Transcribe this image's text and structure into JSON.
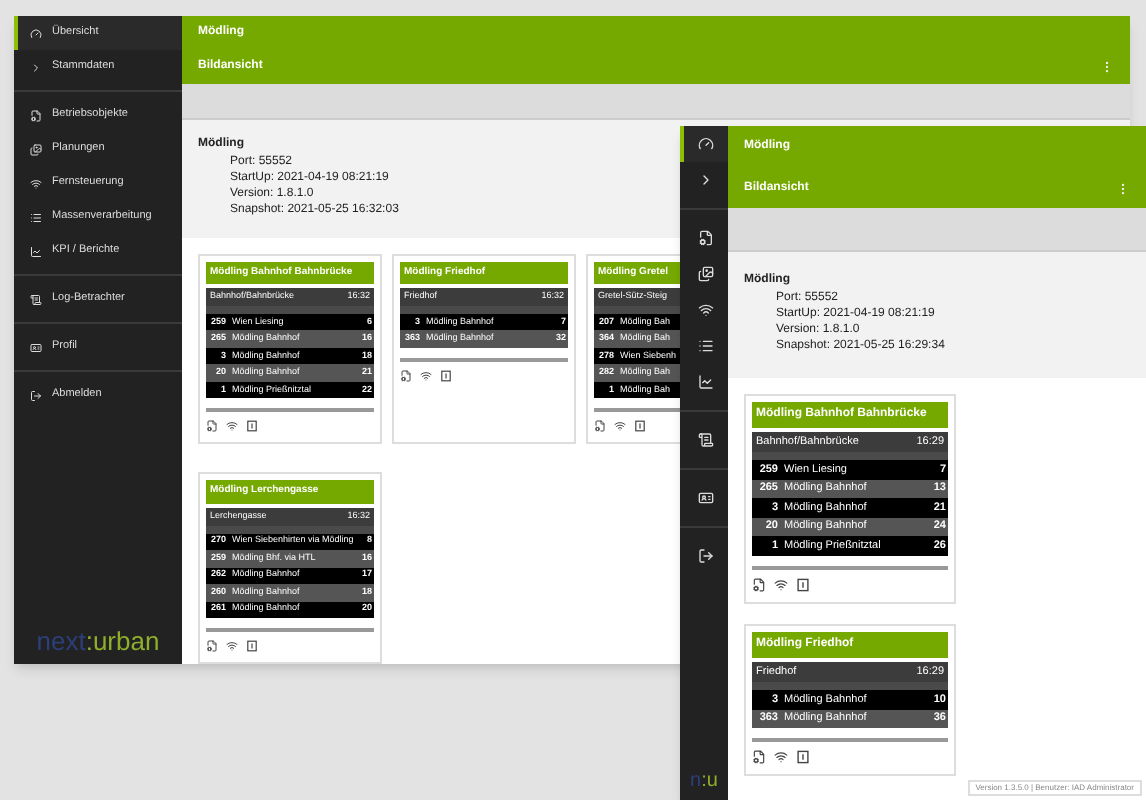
{
  "windows": [
    {
      "sidebar": {
        "collapsed": false,
        "items": [
          {
            "label": "Übersicht",
            "selected": true
          },
          {
            "label": "Stammdaten",
            "selected": false
          },
          {
            "label": "Betriebsobjekte",
            "selected": false
          },
          {
            "label": "Planungen",
            "selected": false
          },
          {
            "label": "Fernsteuerung",
            "selected": false
          },
          {
            "label": "Massenverarbeitung",
            "selected": false
          },
          {
            "label": "KPI / Berichte",
            "selected": false
          },
          {
            "label": "Log-Betrachter",
            "selected": false
          },
          {
            "label": "Profil",
            "selected": false
          },
          {
            "label": "Abmelden",
            "selected": false
          }
        ],
        "logo": [
          "next",
          ":urban"
        ]
      },
      "header": {
        "title": "Mödling",
        "subtitle": "Bildansicht"
      },
      "info": {
        "name": "Mödling",
        "lines": [
          "Port: 55552",
          "StartUp: 2021-04-19 08:21:19",
          "Version: 1.8.1.0",
          "Snapshot: 2021-05-25 16:32:03"
        ]
      },
      "cards": [
        {
          "title": "Mödling Bahnhof Bahnbrücke",
          "stop": "Bahnhof/Bahnbrücke",
          "time": "16:32",
          "rows": [
            {
              "line": "259",
              "destination": "Wien Liesing",
              "minutes": "6"
            },
            {
              "line": "265",
              "destination": "Mödling Bahnhof",
              "minutes": "16"
            },
            {
              "line": "3",
              "destination": "Mödling Bahnhof",
              "minutes": "18"
            },
            {
              "line": "20",
              "destination": "Mödling Bahnhof",
              "minutes": "21"
            },
            {
              "line": "1",
              "destination": "Mödling Prießnitztal",
              "minutes": "22"
            }
          ]
        },
        {
          "title": "Mödling Friedhof",
          "stop": "Friedhof",
          "time": "16:32",
          "rows": [
            {
              "line": "3",
              "destination": "Mödling Bahnhof",
              "minutes": "7"
            },
            {
              "line": "363",
              "destination": "Mödling Bahnhof",
              "minutes": "32"
            }
          ]
        },
        {
          "title": "Mödling Gretel",
          "stop": "Gretel-Sütz-Steig",
          "rows": [
            {
              "line": "207",
              "destination": "Mödling Bah"
            },
            {
              "line": "364",
              "destination": "Mödling Bah"
            },
            {
              "line": "278",
              "destination": "Wien Siebenh"
            },
            {
              "line": "282",
              "destination": "Mödling Bah"
            },
            {
              "line": "1",
              "destination": "Mödling Bah"
            }
          ]
        },
        {
          "title": "Mödling Lerchengasse",
          "stop": "Lerchengasse",
          "time": "16:32",
          "rows": [
            {
              "line": "270",
              "destination": "Wien Siebenhirten via Mödling",
              "minutes": "8"
            },
            {
              "line": "259",
              "destination": "Mödling Bhf. via HTL",
              "minutes": "16"
            },
            {
              "line": "262",
              "destination": "Mödling Bahnhof",
              "minutes": "17"
            },
            {
              "line": "260",
              "destination": "Mödling Bahnhof",
              "minutes": "18"
            },
            {
              "line": "261",
              "destination": "Mödling Bahnhof",
              "minutes": "20"
            }
          ]
        }
      ]
    },
    {
      "sidebar": {
        "collapsed": true,
        "items": [
          {
            "selected": true
          },
          {
            "selected": false
          },
          {
            "selected": false
          },
          {
            "selected": false
          },
          {
            "selected": false
          },
          {
            "selected": false
          },
          {
            "selected": false
          },
          {
            "selected": false
          },
          {
            "selected": false
          },
          {
            "selected": false
          }
        ],
        "logo": [
          "n",
          ":u"
        ]
      },
      "header": {
        "title": "Mödling",
        "subtitle": "Bildansicht"
      },
      "info": {
        "name": "Mödling",
        "lines": [
          "Port: 55552",
          "StartUp: 2021-04-19 08:21:19",
          "Version: 1.8.1.0",
          "Snapshot: 2021-05-25 16:29:34"
        ]
      },
      "cards": [
        {
          "title": "Mödling Bahnhof Bahnbrücke",
          "stop": "Bahnhof/Bahnbrücke",
          "time": "16:29",
          "rows": [
            {
              "line": "259",
              "destination": "Wien Liesing",
              "minutes": "7"
            },
            {
              "line": "265",
              "destination": "Mödling Bahnhof",
              "minutes": "13"
            },
            {
              "line": "3",
              "destination": "Mödling Bahnhof",
              "minutes": "21"
            },
            {
              "line": "20",
              "destination": "Mödling Bahnhof",
              "minutes": "24"
            },
            {
              "line": "1",
              "destination": "Mödling Prießnitztal",
              "minutes": "26"
            }
          ]
        },
        {
          "title": "Mödling Friedhof",
          "stop": "Friedhof",
          "time": "16:29",
          "rows": [
            {
              "line": "3",
              "destination": "Mödling Bahnhof",
              "minutes": "10"
            },
            {
              "line": "363",
              "destination": "Mödling Bahnhof",
              "minutes": "36"
            }
          ]
        }
      ],
      "footer": "Version 1.3.5.0 | Benutzer: IAD Administrator"
    }
  ]
}
